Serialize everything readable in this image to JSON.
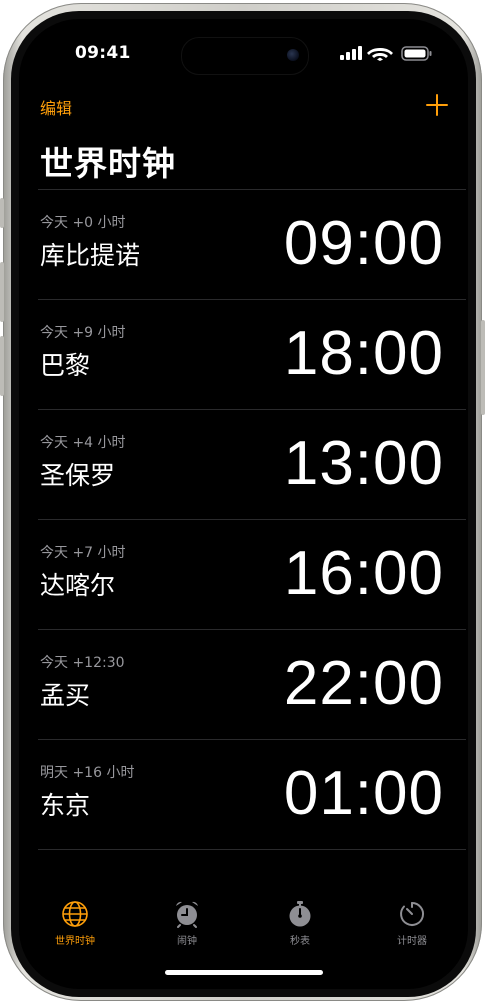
{
  "status_bar": {
    "time": "09:41"
  },
  "nav": {
    "edit_label": "编辑",
    "add_icon": "plus-icon"
  },
  "page": {
    "title": "世界时钟"
  },
  "clocks": [
    {
      "offset": "今天 +0 小时",
      "city": "库比提诺",
      "time": "09:00"
    },
    {
      "offset": "今天 +9 小时",
      "city": "巴黎",
      "time": "18:00"
    },
    {
      "offset": "今天 +4 小时",
      "city": "圣保罗",
      "time": "13:00"
    },
    {
      "offset": "今天 +7 小时",
      "city": "达喀尔",
      "time": "16:00"
    },
    {
      "offset": "今天 +12:30",
      "city": "孟买",
      "time": "22:00"
    },
    {
      "offset": "明天 +16 小时",
      "city": "东京",
      "time": "01:00"
    }
  ],
  "tabs": [
    {
      "label": "世界时钟",
      "icon": "globe-icon",
      "active": true
    },
    {
      "label": "闹钟",
      "icon": "alarm-clock-icon",
      "active": false
    },
    {
      "label": "秒表",
      "icon": "stopwatch-icon",
      "active": false
    },
    {
      "label": "计时器",
      "icon": "timer-icon",
      "active": false
    }
  ],
  "colors": {
    "accent": "#ff9f0a",
    "background": "#000000",
    "secondary_text": "#98989d",
    "inactive_tab": "#8e8e93"
  }
}
